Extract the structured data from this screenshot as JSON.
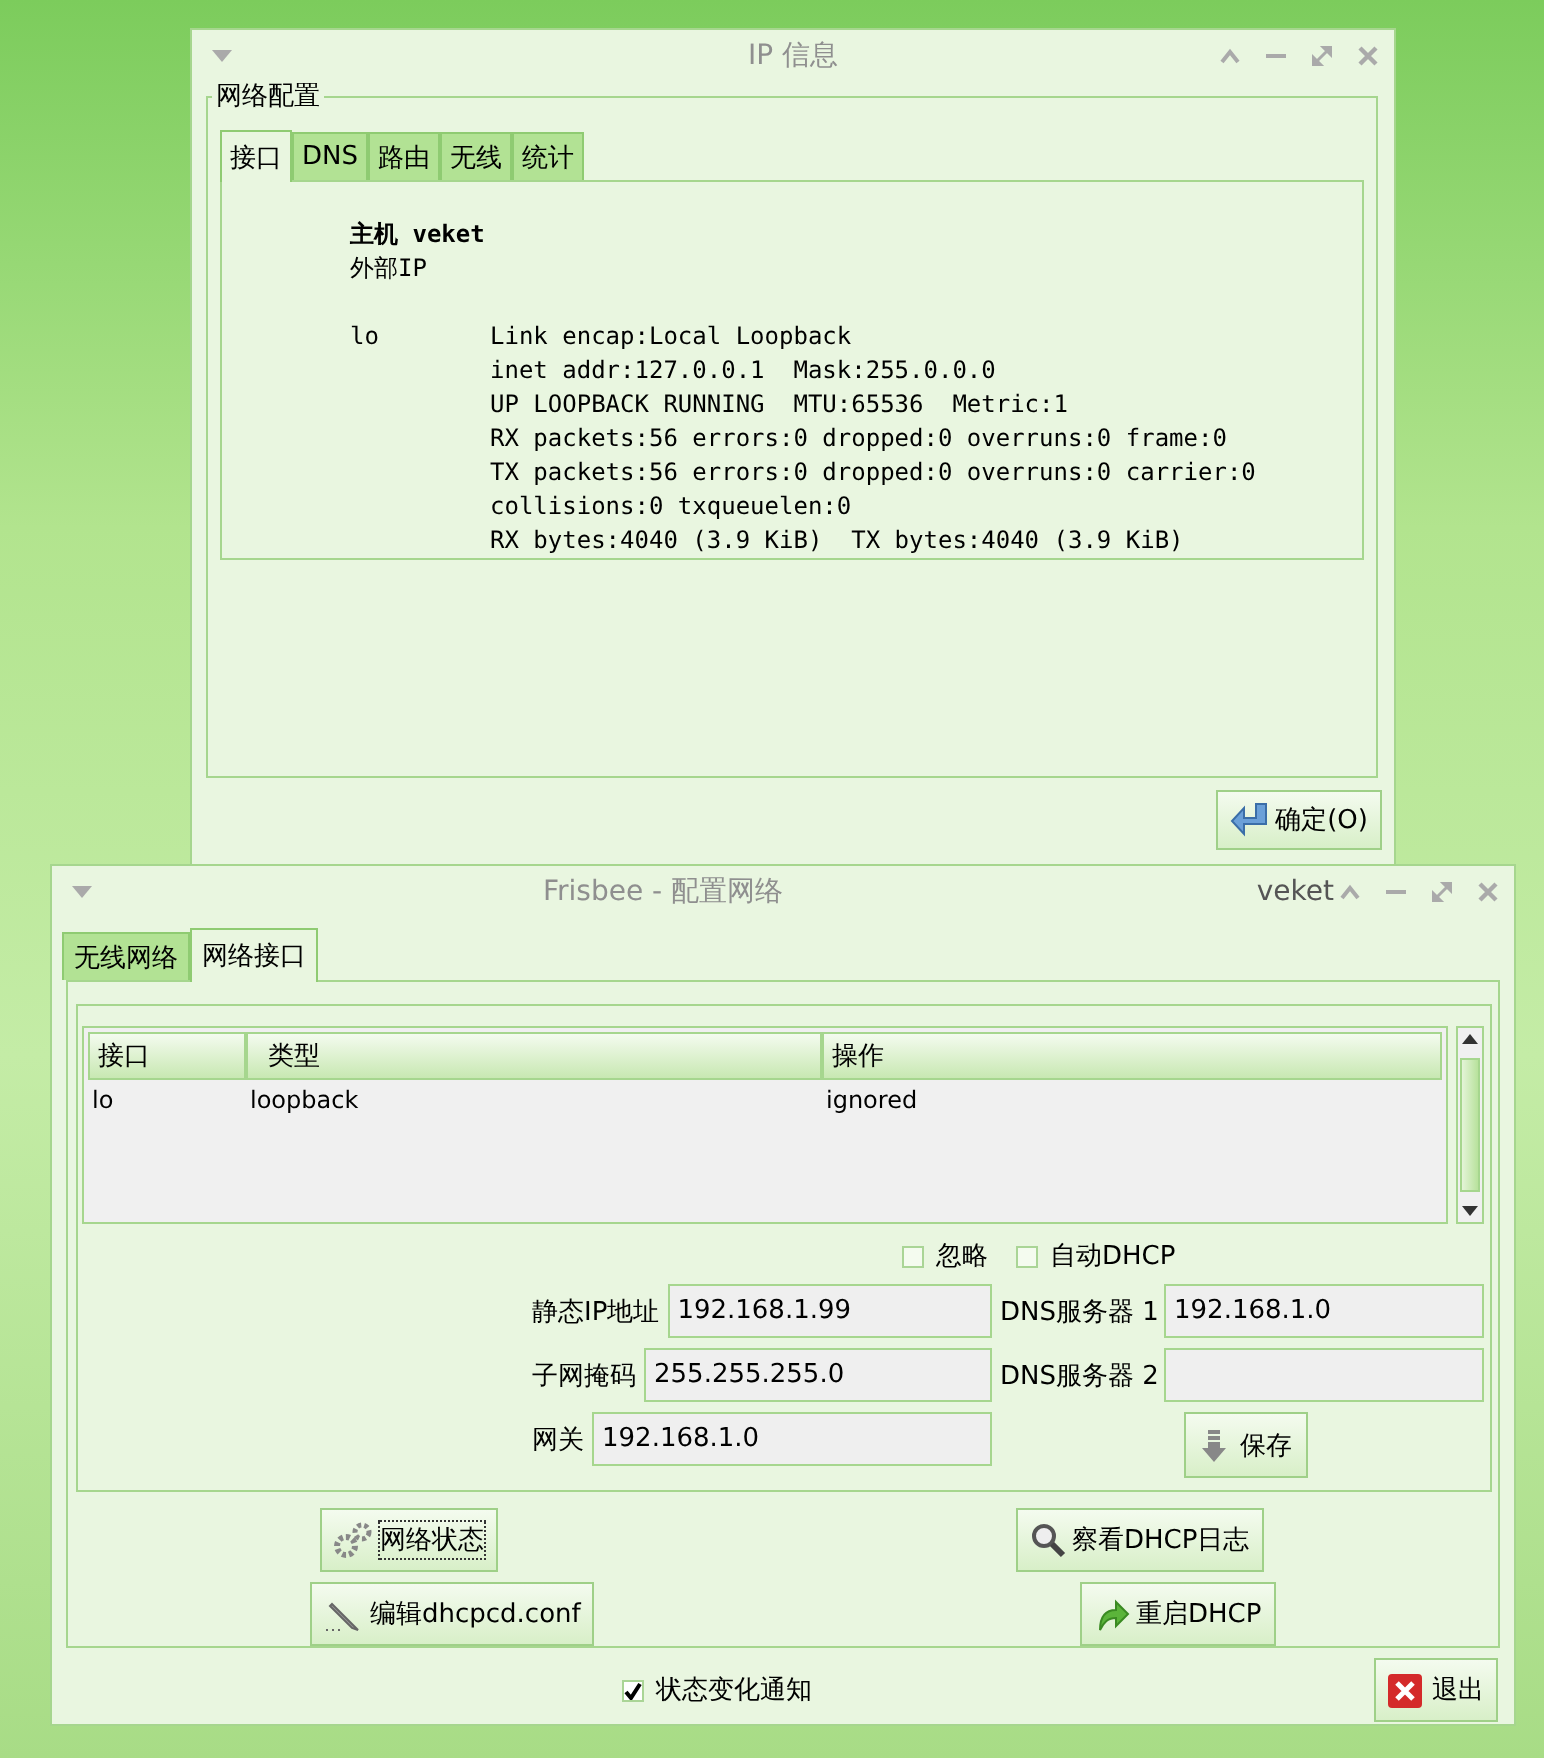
{
  "ip_window": {
    "title": "IP 信息",
    "group_title": "网络配置",
    "tabs": [
      {
        "label": "接口",
        "selected": true
      },
      {
        "label": "DNS",
        "selected": false
      },
      {
        "label": "路由",
        "selected": false
      },
      {
        "label": "无线",
        "selected": false
      },
      {
        "label": "统计",
        "selected": false
      }
    ],
    "host": "主机 veket",
    "external_ip": "外部IP",
    "interfaces": [
      {
        "name": "lo",
        "lines": [
          "Link encap:Local Loopback",
          "inet addr:127.0.0.1  Mask:255.0.0.0",
          "UP LOOPBACK RUNNING  MTU:65536  Metric:1",
          "RX packets:56 errors:0 dropped:0 overruns:0 frame:0",
          "TX packets:56 errors:0 dropped:0 overruns:0 carrier:0",
          "collisions:0 txqueuelen:0",
          "RX bytes:4040 (3.9 KiB)  TX bytes:4040 (3.9 KiB)"
        ]
      }
    ],
    "ok_button": "确定(O)"
  },
  "frisbee_window": {
    "title": "Frisbee - 配置网络",
    "host": "veket",
    "tabs": [
      {
        "label": "无线网络",
        "selected": false
      },
      {
        "label": "网络接口",
        "selected": true
      }
    ],
    "table": {
      "columns": [
        "接口",
        "类型",
        "操作"
      ],
      "rows": [
        [
          "lo",
          "loopback",
          "ignored"
        ]
      ]
    },
    "options": [
      {
        "label": "忽略",
        "checked": false
      },
      {
        "label": "自动DHCP",
        "checked": false
      }
    ],
    "left_fields": [
      {
        "label": "静态IP地址",
        "value": "192.168.1.99"
      },
      {
        "label": "子网掩码",
        "value": "255.255.255.0"
      },
      {
        "label": "网关",
        "value": "192.168.1.0"
      }
    ],
    "right_fields": [
      {
        "label": "DNS服务器 1",
        "value": "192.168.1.0"
      },
      {
        "label": "DNS服务器 2"
      }
    ],
    "save_button": "保存",
    "actions": [
      {
        "kind": "gears",
        "label": "网络状态",
        "focused": true
      },
      {
        "kind": "magnifier",
        "label": "察看DHCP日志",
        "focused": false
      },
      {
        "kind": "pencil",
        "label": "编辑dhcpcd.conf",
        "focused": false
      },
      {
        "kind": "reload",
        "label": "重启DHCP",
        "focused": false
      }
    ],
    "notify": {
      "label": "状态变化通知",
      "checked": true
    },
    "quit_button": "退出"
  }
}
